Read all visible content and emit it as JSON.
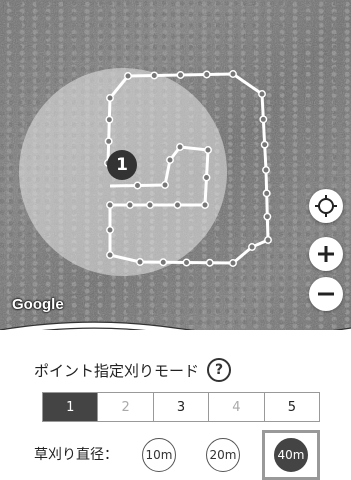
{
  "map": {
    "attribution": "Google",
    "marker_label": "1",
    "controls": {
      "locate_icon": "crosshair-icon",
      "zoom_in_icon": "plus-icon",
      "zoom_out_icon": "minus-icon"
    }
  },
  "panel": {
    "mode_title": "ポイント指定刈りモード",
    "help_label": "?",
    "tabs": [
      "1",
      "2",
      "3",
      "4",
      "5"
    ],
    "active_tab": "1",
    "diameter_label": "草刈り直径：",
    "diameters": [
      "10m",
      "20m",
      "40m"
    ],
    "selected_diameter": "40m"
  },
  "colors": {
    "active_tab_bg": "#444444",
    "selected_pill_bg": "#444444",
    "selection_frame": "#999999"
  }
}
